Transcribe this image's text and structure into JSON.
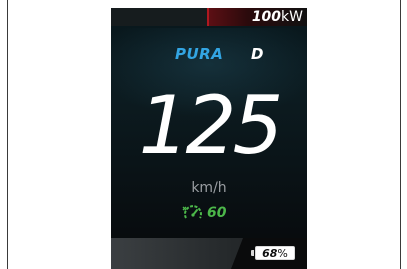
{
  "cluster": {
    "power": {
      "value": "100",
      "unit": "kW"
    },
    "drive_mode": "PURA",
    "gear": "D",
    "speed": {
      "value": "125",
      "unit": "km/h"
    },
    "speed_limit": {
      "icon": "speed-limit-icon",
      "value": "60",
      "color": "#4cb84a"
    },
    "battery": {
      "value": "68",
      "unit": "%"
    }
  },
  "colors": {
    "mode_accent": "#33a5e3",
    "power_bar": "#b01820",
    "background": "#0b1519"
  }
}
